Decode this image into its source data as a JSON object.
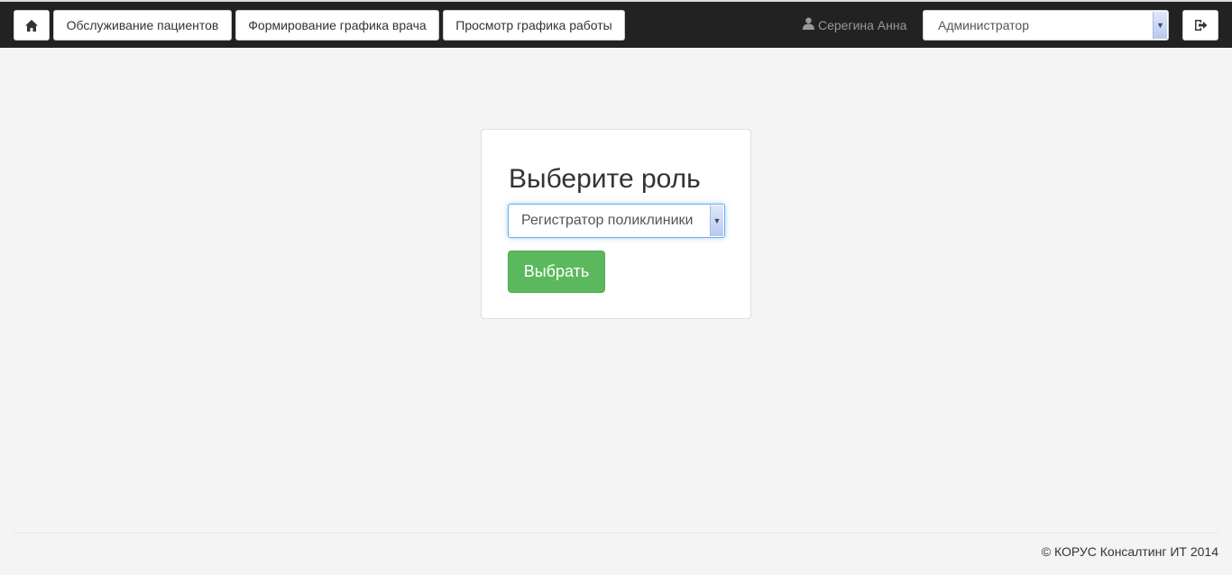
{
  "navbar": {
    "home_icon": "home-icon",
    "patients_label": "Обслуживание пациентов",
    "schedule_form_label": "Формирование графика врача",
    "schedule_view_label": "Просмотр графика работы",
    "user_icon": "user-icon",
    "user_name": "Серегина Анна",
    "role_selected": "Администратор",
    "logout_icon": "logout-icon"
  },
  "role_card": {
    "title": "Выберите роль",
    "selected_role": "Регистратор поликлиники",
    "submit_label": "Выбрать"
  },
  "footer": {
    "copyright": "© КОРУС Консалтинг ИТ 2014"
  },
  "colors": {
    "navbar_bg": "#222222",
    "primary_button": "#5cb85c",
    "page_bg": "#f4f4f4"
  }
}
